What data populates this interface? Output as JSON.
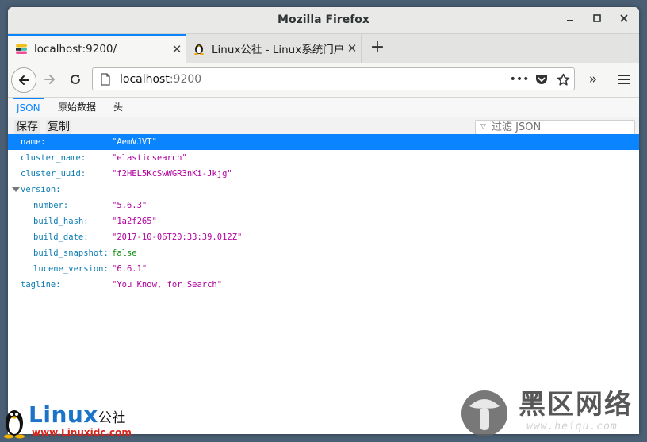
{
  "window": {
    "title": "Mozilla Firefox"
  },
  "tabs": [
    {
      "label": "localhost:9200/",
      "active": true
    },
    {
      "label": "Linux公社 - Linux系统门户",
      "active": false
    }
  ],
  "navbar": {
    "url_host": "localhost",
    "url_port": ":9200"
  },
  "json_viewer": {
    "tabs": [
      "JSON",
      "原始数据",
      "头"
    ],
    "toolbar": {
      "save": "保存",
      "copy": "复制",
      "filter_placeholder": "过滤 JSON"
    },
    "rows": [
      {
        "key": "name:",
        "value": "\"AemVJVT\"",
        "type": "string",
        "depth": 0,
        "selected": true
      },
      {
        "key": "cluster_name:",
        "value": "\"elasticsearch\"",
        "type": "string",
        "depth": 0
      },
      {
        "key": "cluster_uuid:",
        "value": "\"f2HEL5KcSwWGR3nKi-Jkjg\"",
        "type": "string",
        "depth": 0
      },
      {
        "key": "version:",
        "value": "",
        "type": "object",
        "depth": 0,
        "expanded": true
      },
      {
        "key": "number:",
        "value": "\"5.6.3\"",
        "type": "string",
        "depth": 1
      },
      {
        "key": "build_hash:",
        "value": "\"1a2f265\"",
        "type": "string",
        "depth": 1
      },
      {
        "key": "build_date:",
        "value": "\"2017-10-06T20:33:39.012Z\"",
        "type": "string",
        "depth": 1
      },
      {
        "key": "build_snapshot:",
        "value": "false",
        "type": "bool",
        "depth": 1
      },
      {
        "key": "lucene_version:",
        "value": "\"6.6.1\"",
        "type": "string",
        "depth": 1
      },
      {
        "key": "tagline:",
        "value": "\"You Know, for Search\"",
        "type": "string",
        "depth": 0
      }
    ]
  },
  "watermarks": {
    "left_brand": "Linux",
    "left_brand_suffix": "公社",
    "left_url": "www.Linuxidc.com",
    "right_brand": "黑区网络",
    "right_url": "www.heiqu.com"
  },
  "colors": {
    "accent": "#0a84ff",
    "key": "#0b7bb0",
    "string": "#b1009e",
    "bool": "#168f14"
  }
}
